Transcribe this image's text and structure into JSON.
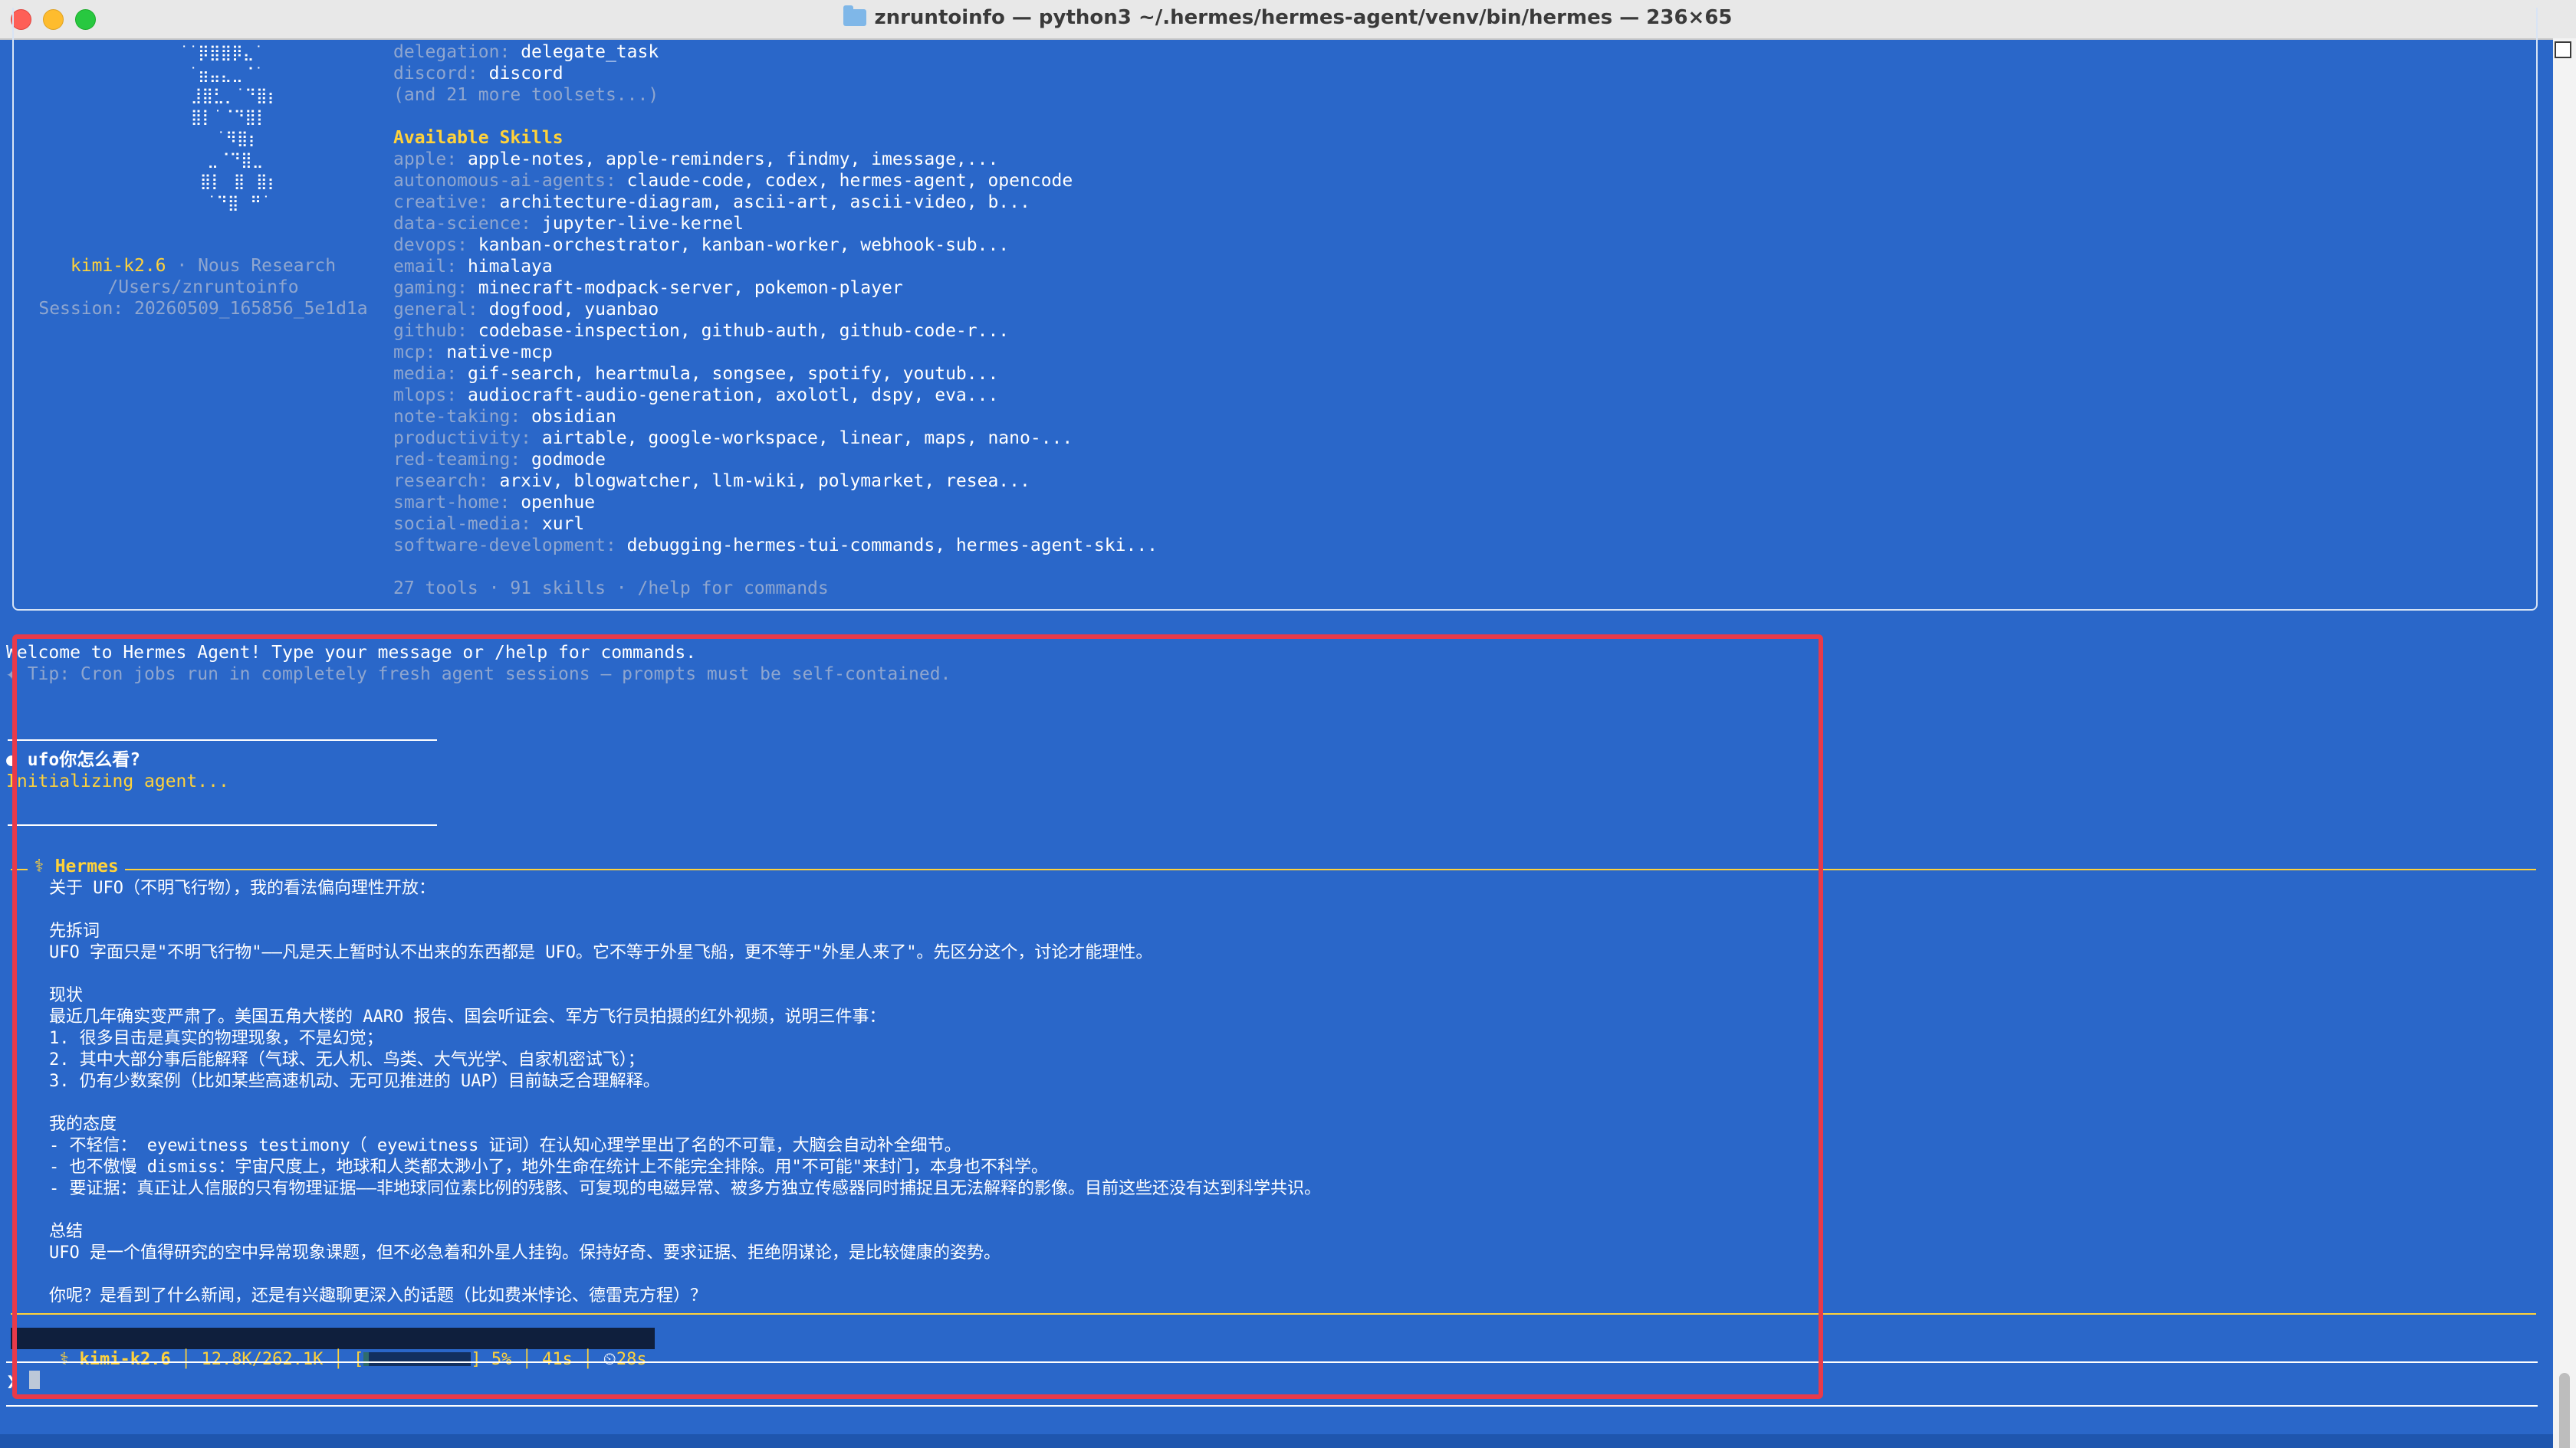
{
  "window": {
    "title": "znruntoinfo — python3 ~/.hermes/hermes-agent/venv/bin/hermes — 236×65"
  },
  "banner": {
    "logo_lines": [
      "  ˙˙⡿⣿⣿⡿⣄˙",
      "   ˙⣶⣤⣄⣀⠈˙",
      "  ⠀⣸⣿⣃⡀˙⠙⣿⡆",
      "  ⠀⣿⡇˙⠈⠙⣿⡇",
      "      ˙⠻⣿⡆",
      "     ⣀⠈⠙⣿⣀",
      "   ⠀⣿⡇⠀⣿⠀⣿⡆",
      "     ˙⠙⣿⠀⠛˙"
    ],
    "model": "kimi-k2.6",
    "provider": "Nous Research",
    "cwd": "/Users/znruntoinfo",
    "session": "Session: 20260509_165856_5e1d1a",
    "toolsets_partial": [
      {
        "key": "delegation:",
        "value": "delegate_task"
      },
      {
        "key": "discord:",
        "value": "discord"
      }
    ],
    "more_toolsets": "(and 21 more toolsets...)",
    "skills_heading": "Available Skills",
    "skills": [
      {
        "key": "apple:",
        "value": "apple-notes, apple-reminders, findmy, imessage,..."
      },
      {
        "key": "autonomous-ai-agents:",
        "value": "claude-code, codex, hermes-agent, opencode"
      },
      {
        "key": "creative:",
        "value": "architecture-diagram, ascii-art, ascii-video, b..."
      },
      {
        "key": "data-science:",
        "value": "jupyter-live-kernel"
      },
      {
        "key": "devops:",
        "value": "kanban-orchestrator, kanban-worker, webhook-sub..."
      },
      {
        "key": "email:",
        "value": "himalaya"
      },
      {
        "key": "gaming:",
        "value": "minecraft-modpack-server, pokemon-player"
      },
      {
        "key": "general:",
        "value": "dogfood, yuanbao"
      },
      {
        "key": "github:",
        "value": "codebase-inspection, github-auth, github-code-r..."
      },
      {
        "key": "mcp:",
        "value": "native-mcp"
      },
      {
        "key": "media:",
        "value": "gif-search, heartmula, songsee, spotify, youtub..."
      },
      {
        "key": "mlops:",
        "value": "audiocraft-audio-generation, axolotl, dspy, eva..."
      },
      {
        "key": "note-taking:",
        "value": "obsidian"
      },
      {
        "key": "productivity:",
        "value": "airtable, google-workspace, linear, maps, nano-..."
      },
      {
        "key": "red-teaming:",
        "value": "godmode"
      },
      {
        "key": "research:",
        "value": "arxiv, blogwatcher, llm-wiki, polymarket, resea..."
      },
      {
        "key": "smart-home:",
        "value": "openhue"
      },
      {
        "key": "social-media:",
        "value": "xurl"
      },
      {
        "key": "software-development:",
        "value": "debugging-hermes-tui-commands, hermes-agent-ski..."
      }
    ],
    "summary": "27 tools · 91 skills · /help for commands"
  },
  "session_log": {
    "welcome": "Welcome to Hermes Agent! Type your message or /help for commands.",
    "tip": "✦ Tip: Cron jobs run in completely fresh agent sessions — prompts must be self-contained.",
    "user_message": "ufo你怎么看?",
    "user_marker": "●",
    "initializing": "Initializing agent...",
    "assistant_label": "⚕ Hermes",
    "response_lines": [
      "关于 UFO（不明飞行物），我的看法偏向理性开放：",
      "",
      "先拆词",
      "UFO 字面只是\"不明飞行物\"——凡是天上暂时认不出来的东西都是 UFO。它不等于外星飞船，更不等于\"外星人来了\"。先区分这个，讨论才能理性。",
      "",
      "现状",
      "最近几年确实变严肃了。美国五角大楼的 AARO 报告、国会听证会、军方飞行员拍摄的红外视频，说明三件事：",
      "1. 很多目击是真实的物理现象，不是幻觉；",
      "2. 其中大部分事后能解释（气球、无人机、鸟类、大气光学、自家机密试飞）；",
      "3. 仍有少数案例（比如某些高速机动、无可见推进的 UAP）目前缺乏合理解释。",
      "",
      "我的态度",
      "- 不轻信： eyewitness testimony（ eyewitness 证词）在认知心理学里出了名的不可靠，大脑会自动补全细节。",
      "- 也不傲慢 dismiss：宇宙尺度上，地球和人类都太渺小了，地外生命在统计上不能完全排除。用\"不可能\"来封门，本身也不科学。",
      "- 要证据：真正让人信服的只有物理证据——非地球同位素比例的残骸、可复现的电磁异常、被多方独立传感器同时捕捉且无法解释的影像。目前这些还没有达到科学共识。",
      "",
      "总结",
      "UFO 是一个值得研究的空中异常现象课题，但不必急着和外星人挂钩。保持好奇、要求证据、拒绝阴谋论，是比较健康的姿势。",
      "",
      "你呢？是看到了什么新闻，还是有兴趣聊更深入的话题（比如费米悖论、德雷克方程）？"
    ]
  },
  "statusbar": {
    "icon": "⚕",
    "model": "kimi-k2.6",
    "tokens": "12.8K/262.1K",
    "progress_open": "[",
    "progress_close": "]",
    "progress_percent": "5%",
    "progress_value": 0.05,
    "elapsed": "41s",
    "timer_icon": "⏲",
    "timer": "28s"
  },
  "input": {
    "prompt": "❯",
    "value": ""
  }
}
